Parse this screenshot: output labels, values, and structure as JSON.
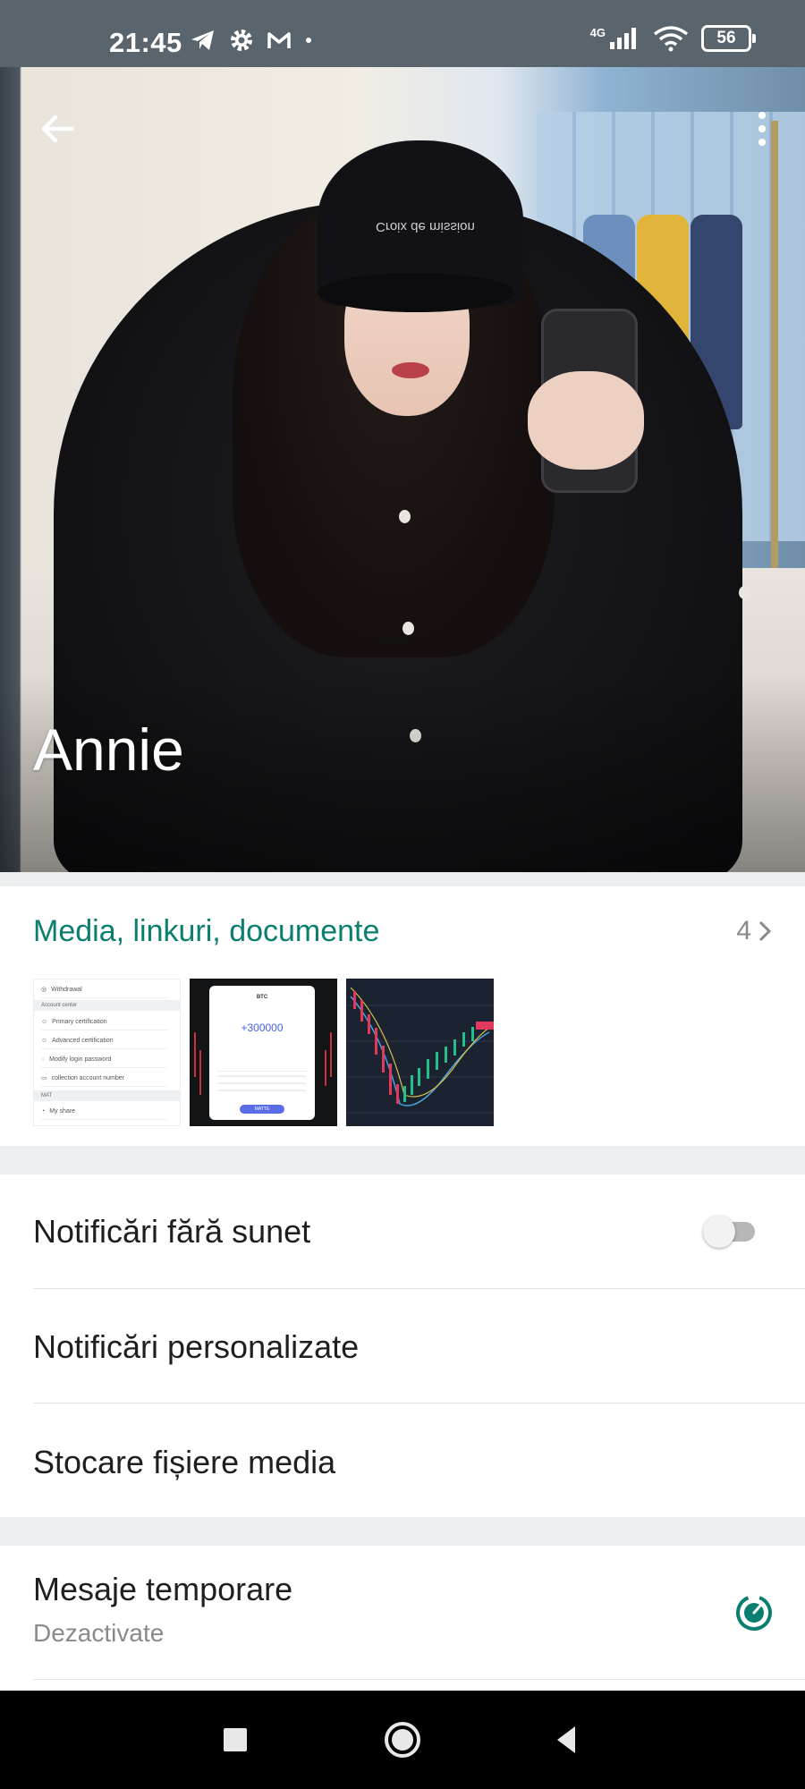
{
  "status_bar": {
    "time": "21:45",
    "network": "4G",
    "battery": "56",
    "left_icons": [
      "telegram-icon",
      "gear-icon",
      "gmail-icon",
      "dot-icon"
    ],
    "right_icons": [
      "signal-icon",
      "wifi-icon",
      "battery-icon"
    ]
  },
  "header": {
    "contact_name": "Annie",
    "cap_text": "Croix de mission"
  },
  "media": {
    "title": "Media, linkuri, documente",
    "count": "4",
    "thumbnails": [
      {
        "kind": "screenshot-settings",
        "rows": [
          "Withdrawal",
          "Primary certification",
          "Advanced certification",
          "Modify login password",
          "collection account number",
          "My share"
        ],
        "headers": [
          "Account center",
          "MAT"
        ]
      },
      {
        "kind": "screenshot-btc",
        "coin": "BTC",
        "amount": "+300000",
        "button": "MATTE"
      },
      {
        "kind": "candlestick-chart"
      }
    ]
  },
  "settings": {
    "mute_label": "Notificări fără sunet",
    "mute_on": false,
    "custom_label": "Notificări personalizate",
    "media_storage_label": "Stocare fișiere media",
    "disappearing_title": "Mesaje temporare",
    "disappearing_value": "Dezactivate"
  },
  "colors": {
    "accent": "#0a7f6f",
    "status_bar": "#59646c",
    "nav_bar": "#000000"
  }
}
